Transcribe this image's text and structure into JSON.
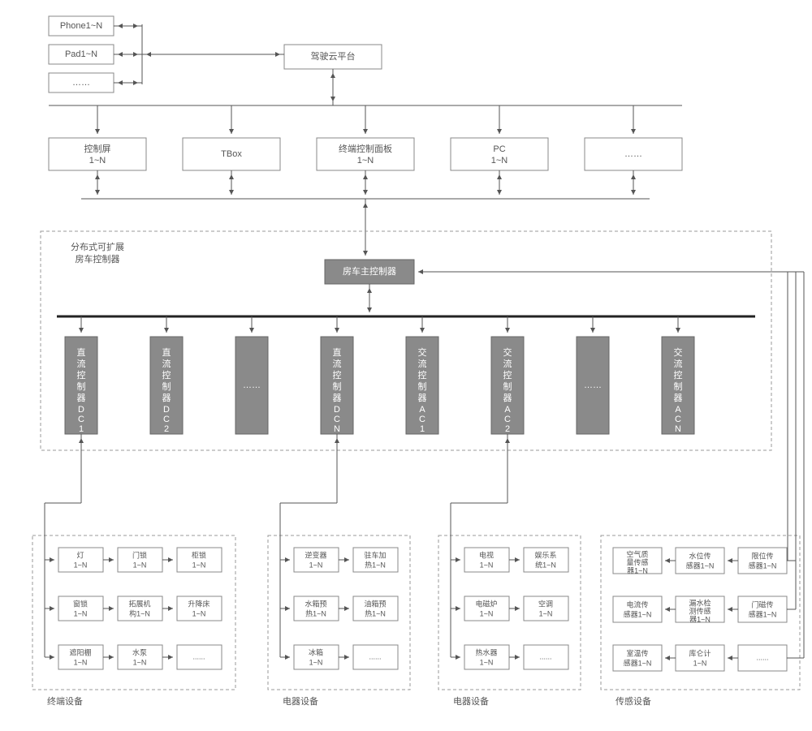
{
  "top_devices": [
    "Phone1~N",
    "Pad1~N",
    "……"
  ],
  "cloud": "驾驶云平台",
  "panels": [
    "控制屏\n1~N",
    "TBox",
    "终端控制面板\n1~N",
    "PC\n1~N",
    "……"
  ],
  "dist_label": "分布式可扩展\n房车控制器",
  "main_ctrl": "房车主控制器",
  "sub_ctrls": [
    "直流控制器DC1",
    "直流控制器DC2",
    "……",
    "直流控制器DCN",
    "交流控制器AC1",
    "交流控制器AC2",
    "……",
    "交流控制器ACN"
  ],
  "group_labels": [
    "终端设备",
    "电器设备",
    "电器设备",
    "传感设备"
  ],
  "groups": [
    [
      [
        "灯\n1~N",
        "门锁\n1~N",
        "柜锁\n1~N"
      ],
      [
        "窗锁\n1~N",
        "拓展机构1~N",
        "升降床\n1~N"
      ],
      [
        "遮阳棚\n1~N",
        "水泵\n1~N",
        "......"
      ]
    ],
    [
      [
        "逆变器\n1~N",
        "驻车加热1~N"
      ],
      [
        "水箱预热1~N",
        "油箱预热1~N"
      ],
      [
        "冰箱\n1~N",
        "......"
      ]
    ],
    [
      [
        "电视\n1~N",
        "娱乐系统1~N"
      ],
      [
        "电磁炉\n1~N",
        "空调\n1~N"
      ],
      [
        "热水器\n1~N",
        "......"
      ]
    ],
    [
      [
        "空气质量传感器1~N",
        "水位传感器\n1~N",
        "限位传感器\n1~N"
      ],
      [
        "电流传感器\n1~N",
        "漏水检测传感器1~N",
        "门磁传感器\n1~N"
      ],
      [
        "室温传感器\n1~N",
        "库仑计\n1~N",
        "......"
      ]
    ]
  ]
}
